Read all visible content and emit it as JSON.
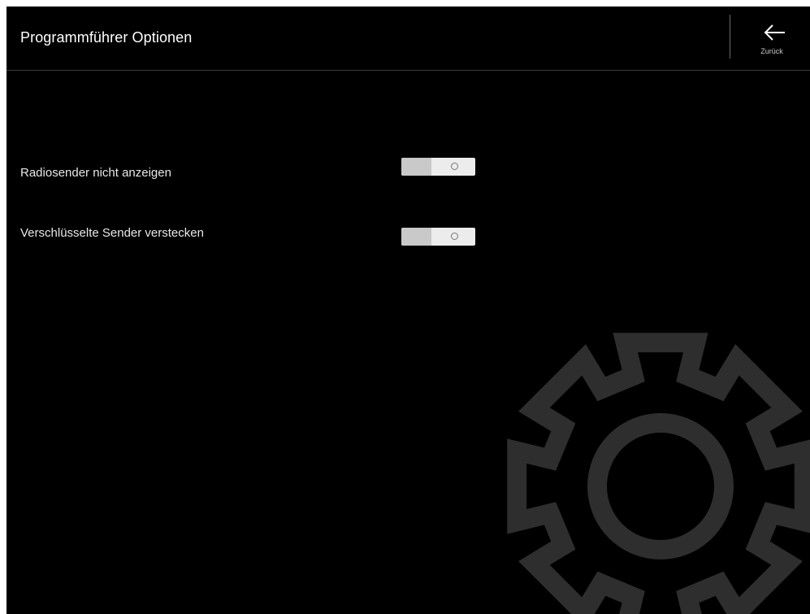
{
  "header": {
    "title": "Programmführer Optionen",
    "back_label": "Zurück",
    "back_icon": "arrow-left-icon"
  },
  "settings": [
    {
      "label": "Radiosender nicht anzeigen",
      "enabled": false
    },
    {
      "label": "Verschlüsselte Sender verstecken",
      "enabled": false
    }
  ],
  "background_icon": "gear-icon",
  "colors": {
    "background": "#000000",
    "text": "#ffffff",
    "toggle_track": "#ececec",
    "gear": "#2e2e2e"
  }
}
